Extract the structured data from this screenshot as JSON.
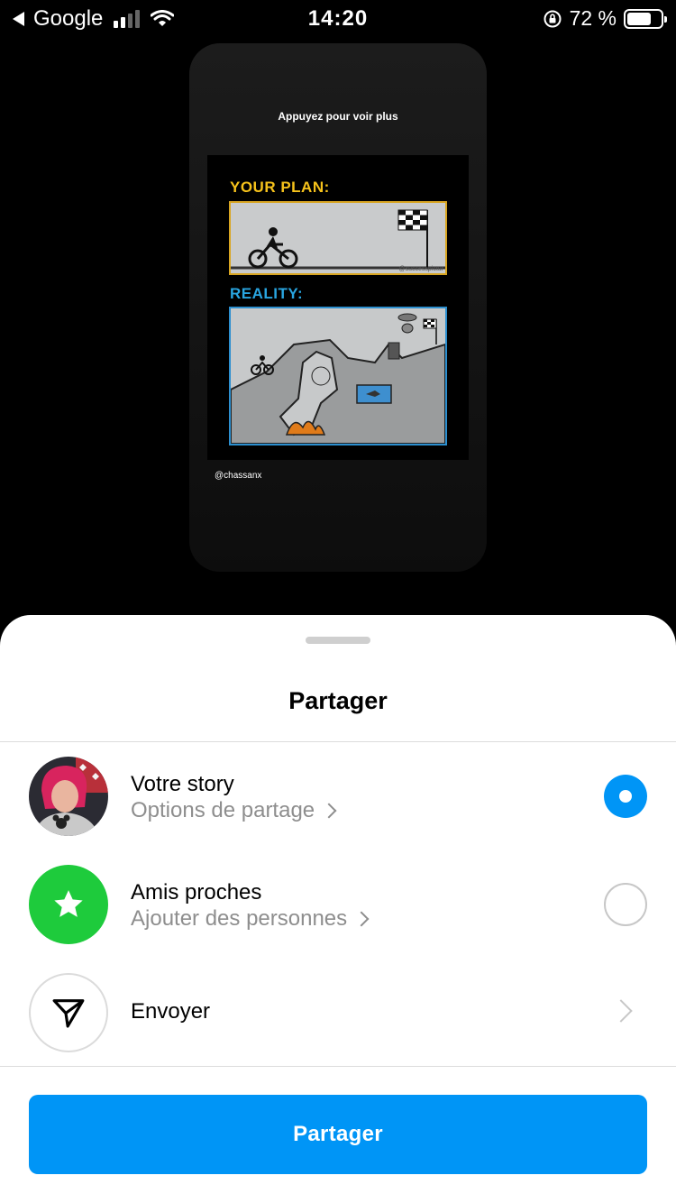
{
  "status_bar": {
    "back_app": "Google",
    "time": "14:20",
    "battery_percent": "72 %",
    "battery_level": 0.72,
    "signal_bars_active": 2
  },
  "story_preview": {
    "hint": "Appuyez pour voir plus",
    "plan_label": "YOUR PLAN:",
    "reality_label": "REALITY:",
    "watermark": "@successpictur",
    "handle": "@chassanx"
  },
  "sheet": {
    "title": "Partager",
    "options": [
      {
        "title": "Votre story",
        "subtitle": "Options de partage",
        "selected": true
      },
      {
        "title": "Amis proches",
        "subtitle": "Ajouter des personnes",
        "selected": false
      },
      {
        "title": "Envoyer"
      }
    ],
    "share_button": "Partager"
  },
  "colors": {
    "accent": "#0095f6",
    "close_friends": "#1ecb3c",
    "plan_yellow": "#f6c21b",
    "reality_blue": "#29a5e0"
  },
  "icons": [
    "back-arrow-icon",
    "signal-icon",
    "wifi-icon",
    "rotation-lock-icon",
    "battery-icon",
    "star-icon",
    "send-icon",
    "chevron-right-icon"
  ]
}
